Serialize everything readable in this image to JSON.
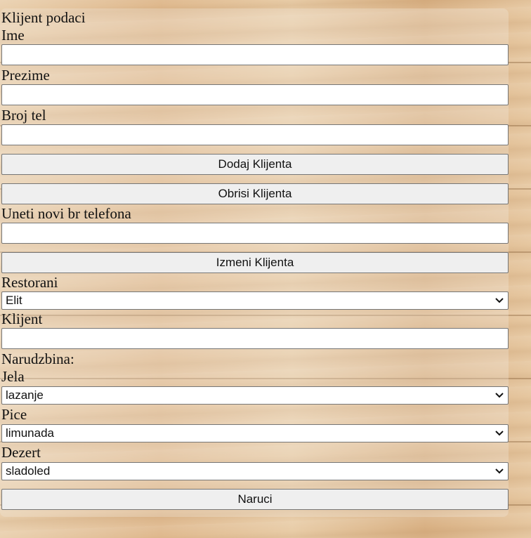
{
  "form": {
    "heading": "Klijent podaci",
    "ime_label": "Ime",
    "ime_value": "",
    "prezime_label": "Prezime",
    "prezime_value": "",
    "broj_tel_label": "Broj tel",
    "broj_tel_value": "",
    "dodaj_button": "Dodaj Klijenta",
    "obrisi_button": "Obrisi Klijenta",
    "novi_tel_label": "Uneti novi br telefona",
    "novi_tel_value": "",
    "izmeni_button": "Izmeni Klijenta",
    "restorani_label": "Restorani",
    "restorani_selected": "Elit",
    "klijent_label": "Klijent",
    "klijent_value": "",
    "narudzbina_label": "Narudzbina:",
    "jela_label": "Jela",
    "jela_selected": "lazanje",
    "pice_label": "Pice",
    "pice_selected": "limunada",
    "dezert_label": "Dezert",
    "dezert_selected": "sladoled",
    "naruci_button": "Naruci"
  },
  "icons": {
    "dropdown": "chevron-down-icon"
  },
  "colors": {
    "background_wood": "#e2c19a",
    "button_bg": "#efefef",
    "input_border": "#767676"
  }
}
